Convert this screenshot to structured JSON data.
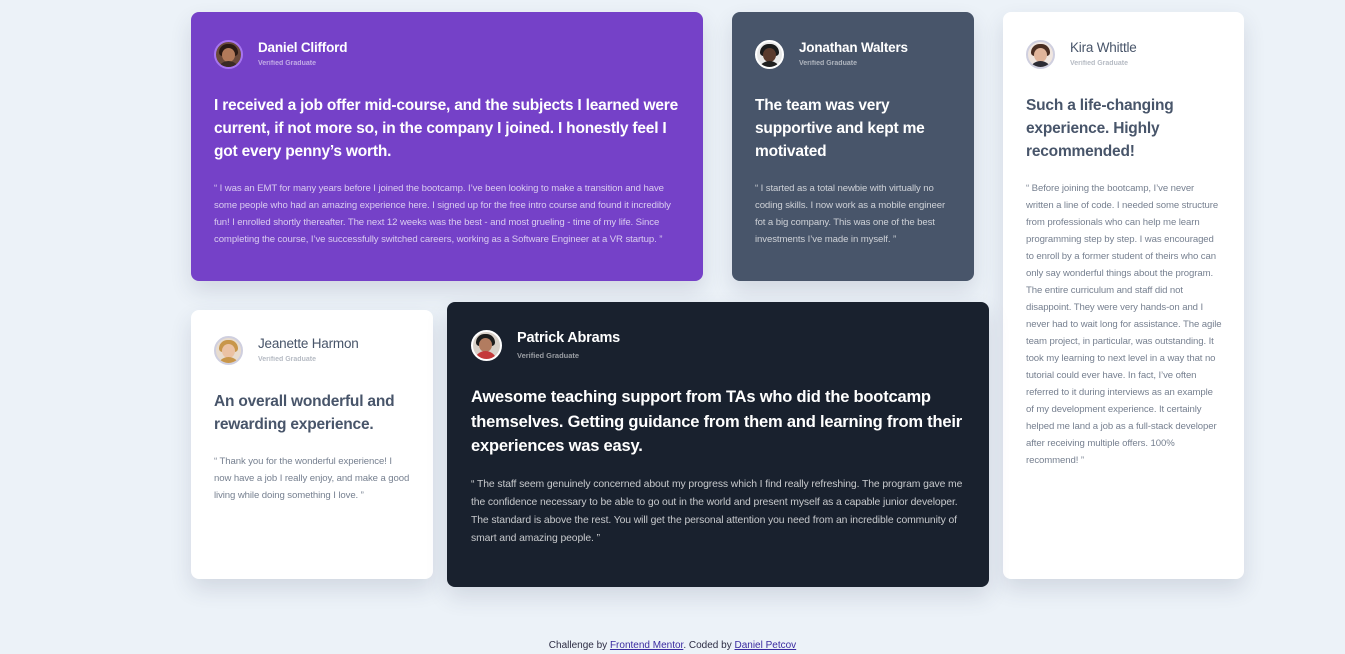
{
  "testimonials": {
    "daniel": {
      "name": "Daniel Clifford",
      "role": "Verified Graduate",
      "headline": "I received a job offer mid-course, and the subjects I learned were current, if not more so, in the company I joined. I honestly feel I got every penny’s worth.",
      "quote": "“ I was an EMT for many years before I joined the bootcamp. I’ve been looking to make a transition and have some people who had an amazing experience here. I signed up for the free intro course and found it incredibly fun! I enrolled shortly thereafter. The next 12 weeks was the best - and most grueling - time of my life. Since completing the course, I’ve successfully switched careers, working as a Software Engineer at a VR startup. ”",
      "avatar_icon": "avatar-daniel-icon"
    },
    "jonathan": {
      "name": "Jonathan Walters",
      "role": "Verified Graduate",
      "headline": "The team was very supportive and kept me motivated",
      "quote": "“ I started as a total newbie with virtually no coding skills. I now work as a mobile engineer fot a big company. This was one of the best investments I’ve made in myself. ”",
      "avatar_icon": "avatar-jonathan-icon"
    },
    "kira": {
      "name": "Kira Whittle",
      "role": "Verified Graduate",
      "headline": "Such a life-changing experience. Highly recommended!",
      "quote": "“ Before joining the bootcamp, I’ve never written a line of code. I needed some structure from professionals who can help me learn programming step by step. I was encouraged to enroll by a former student of theirs who can only say wonderful things about the program. The entire curriculum and staff did not disappoint. They were very hands-on and I never had to wait long for assistance. The agile team project, in particular, was outstanding. It took my learning to next level in a way that no tutorial could ever have. In fact, I’ve often referred to it during interviews as an example of my development experience. It certainly helped me land a job as a full-stack developer after receiving multiple offers. 100% recommend! ”",
      "avatar_icon": "avatar-kira-icon"
    },
    "jeanette": {
      "name": "Jeanette Harmon",
      "role": "Verified Graduate",
      "headline": "An overall wonderful and rewarding experience.",
      "quote": "“ Thank you for the wonderful experience! I now have a job I really enjoy, and make a good living while doing something I love. ”",
      "avatar_icon": "avatar-jeanette-icon"
    },
    "patrick": {
      "name": "Patrick Abrams",
      "role": "Verified Graduate",
      "headline": "Awesome teaching support from TAs who did the bootcamp themselves. Getting guidance from them and learning from their experiences was easy.",
      "quote": "“ The staff seem genuinely concerned about my progress which I find really refreshing. The program gave me the confidence necessary to be able to go out in the world and present myself as a capable junior developer. The standard is above the rest. You will get the personal attention you need from an incredible community of smart and amazing people. ”",
      "avatar_icon": "avatar-patrick-icon"
    }
  },
  "footer": {
    "prefix": "Challenge by ",
    "challenge_link": "Frontend Mentor",
    "middle": ". Coded by ",
    "author_link": "Daniel Petcov"
  },
  "colors": {
    "page_bg": "#ecf2f8",
    "purple": "#7541c8",
    "grayblue": "#48556a",
    "dark": "#19212e",
    "white": "#ffffff"
  }
}
